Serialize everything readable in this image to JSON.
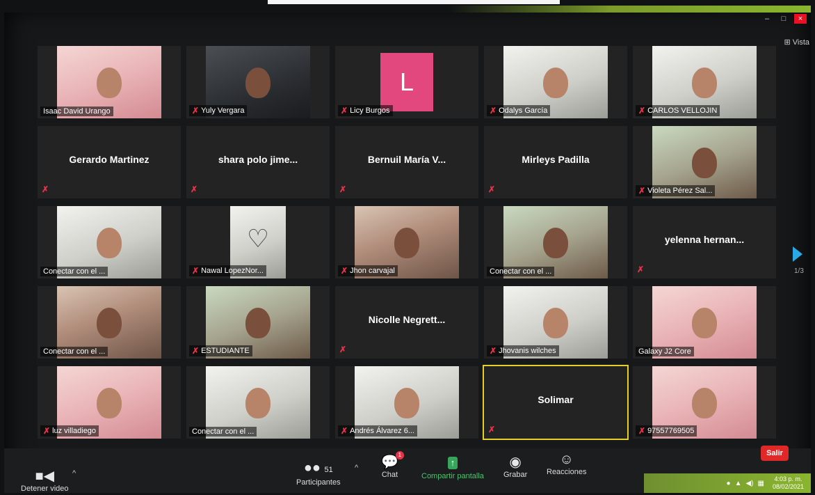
{
  "window": {
    "controls": [
      "–",
      "□",
      "×"
    ],
    "view_label": "Vista",
    "view_icon": "grid-icon"
  },
  "participants": [
    {
      "name": "Isaac David Urango",
      "muted": false,
      "kind": "video",
      "style": "pink"
    },
    {
      "name": "Yuly Vergara",
      "muted": true,
      "kind": "video",
      "style": "dark"
    },
    {
      "name": "Licy Burgos",
      "muted": true,
      "kind": "avatar",
      "avatar_letter": "L",
      "avatar_color": "#e2487d"
    },
    {
      "name": "Odalys García",
      "muted": true,
      "kind": "video",
      "style": "light"
    },
    {
      "name": "CARLOS VELLOJIN",
      "muted": true,
      "kind": "video",
      "style": "light"
    },
    {
      "name": "Gerardo Martinez",
      "muted": true,
      "kind": "name"
    },
    {
      "name": "shara  polo jime...",
      "muted": true,
      "kind": "name"
    },
    {
      "name": "Bernuil María V...",
      "muted": true,
      "kind": "name"
    },
    {
      "name": "Mirleys Padilla",
      "muted": true,
      "kind": "name"
    },
    {
      "name": "Violeta Pérez Sal...",
      "muted": true,
      "kind": "video",
      "style": "outdoor"
    },
    {
      "name": "Conectar con el ...",
      "muted": false,
      "kind": "video",
      "style": "light"
    },
    {
      "name": "Nawal LopezNor...",
      "muted": true,
      "kind": "heart"
    },
    {
      "name": "Jhon carvajal",
      "muted": true,
      "kind": "video",
      "style": "default"
    },
    {
      "name": "Conectar con el ...",
      "muted": false,
      "kind": "video",
      "style": "outdoor"
    },
    {
      "name": "yelenna  hernan...",
      "muted": true,
      "kind": "name"
    },
    {
      "name": "Conectar con el ...",
      "muted": false,
      "kind": "video",
      "style": "default"
    },
    {
      "name": "ESTUDIANTE",
      "muted": true,
      "kind": "video",
      "style": "outdoor"
    },
    {
      "name": "Nicolle  Negrett...",
      "muted": true,
      "kind": "name"
    },
    {
      "name": "Jhovanis wilches",
      "muted": true,
      "kind": "video",
      "style": "light"
    },
    {
      "name": "Galaxy J2 Core",
      "muted": false,
      "kind": "video",
      "style": "pink"
    },
    {
      "name": "luz villadiego",
      "muted": true,
      "kind": "video",
      "style": "pink"
    },
    {
      "name": "Conectar con el ...",
      "muted": false,
      "kind": "video",
      "style": "light"
    },
    {
      "name": "Andrés Álvarez 6...",
      "muted": true,
      "kind": "video",
      "style": "light"
    },
    {
      "name": "Solimar",
      "muted": true,
      "kind": "name",
      "active": true
    },
    {
      "name": "97557769505",
      "muted": true,
      "kind": "video",
      "style": "pink"
    }
  ],
  "pagination": {
    "label": "1/3"
  },
  "toolbar": {
    "video_label": "Detener video",
    "participants_count": "51",
    "participants_label": "Participantes",
    "chat_label": "Chat",
    "chat_badge": "1",
    "share_label": "Compartir pantalla",
    "record_label": "Grabar",
    "reactions_label": "Reacciones",
    "exit_label": "Salir"
  },
  "taskbar": {
    "time": "4:03 p. m.",
    "date": "08/02/2021"
  },
  "colors": {
    "share_green": "#4cc46e",
    "exit_red": "#e02828",
    "mute_red": "#e8344a",
    "active_speaker": "#e6d028"
  }
}
